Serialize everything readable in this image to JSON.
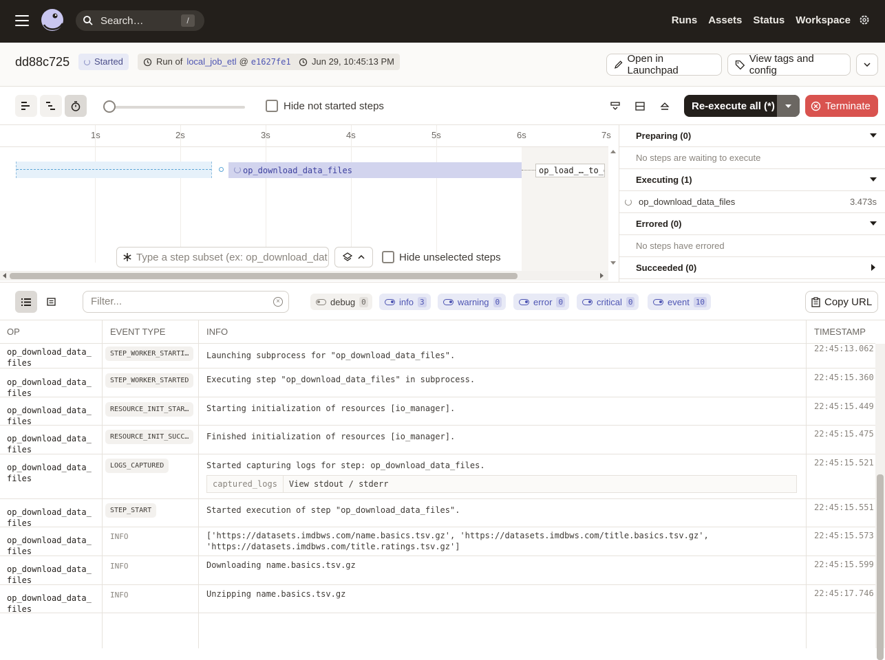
{
  "nav": {
    "search_placeholder": "Search…",
    "search_key": "/",
    "links": [
      "Runs",
      "Assets",
      "Status",
      "Workspace"
    ]
  },
  "run": {
    "id": "dd88c725",
    "status": "Started",
    "run_of_prefix": "Run of",
    "job": "local_job_etl",
    "at": "@",
    "snapshot": "e1627fe1",
    "time": "Jun 29, 10:45:13 PM",
    "open_launchpad": "Open in Launchpad",
    "view_tags": "View tags and config"
  },
  "toolbar": {
    "hide_not_started": "Hide not started steps",
    "reexecute": "Re-execute all (*)",
    "terminate": "Terminate"
  },
  "gantt": {
    "ticks": [
      "1s",
      "2s",
      "3s",
      "4s",
      "5s",
      "6s",
      "7s"
    ],
    "exec_step": "op_download_data_files",
    "next_step": "op_load_…_to_db",
    "subset_placeholder": "Type a step subset (ex: op_download_dat",
    "hide_unselected": "Hide unselected steps"
  },
  "steps": {
    "preparing": "Preparing (0)",
    "preparing_empty": "No steps are waiting to execute",
    "executing": "Executing (1)",
    "executing_item": "op_download_data_files",
    "executing_time": "3.473s",
    "errored": "Errored (0)",
    "errored_empty": "No steps have errored",
    "succeeded": "Succeeded (0)"
  },
  "filters": {
    "placeholder": "Filter...",
    "levels": [
      {
        "label": "debug",
        "count": "0"
      },
      {
        "label": "info",
        "count": "3"
      },
      {
        "label": "warning",
        "count": "0"
      },
      {
        "label": "error",
        "count": "0"
      },
      {
        "label": "critical",
        "count": "0"
      },
      {
        "label": "event",
        "count": "10"
      }
    ],
    "copy_url": "Copy URL"
  },
  "logs": {
    "columns": [
      "OP",
      "EVENT TYPE",
      "INFO",
      "TIMESTAMP"
    ],
    "rows": [
      {
        "op": "op_download_data_files",
        "event": "STEP_WORKER_STARTI…",
        "info": "Launching subprocess for \"op_download_data_files\".",
        "ts": "22:45:13.062"
      },
      {
        "op": "op_download_data_files",
        "event": "STEP_WORKER_STARTED",
        "info": "Executing step \"op_download_data_files\" in subprocess.",
        "ts": "22:45:15.360"
      },
      {
        "op": "op_download_data_files",
        "event": "RESOURCE_INIT_STAR…",
        "info": "Starting initialization of resources [io_manager].",
        "ts": "22:45:15.449"
      },
      {
        "op": "op_download_data_files",
        "event": "RESOURCE_INIT_SUCC…",
        "info": "Finished initialization of resources [io_manager].",
        "ts": "22:45:15.475"
      },
      {
        "op": "op_download_data_files",
        "event": "LOGS_CAPTURED",
        "info": "Started capturing logs for step: op_download_data_files.",
        "ts": "22:45:15.521",
        "box_key": "captured_logs",
        "box_val": "View stdout / stderr"
      },
      {
        "op": "op_download_data_files",
        "event": "STEP_START",
        "info": "Started execution of step \"op_download_data_files\".",
        "ts": "22:45:15.551"
      },
      {
        "op": "op_download_data_files",
        "event": "INFO",
        "info": "['https://datasets.imdbws.com/name.basics.tsv.gz', 'https://datasets.imdbws.com/title.basics.tsv.gz', 'https://datasets.imdbws.com/title.ratings.tsv.gz']",
        "ts": "22:45:15.573"
      },
      {
        "op": "op_download_data_files",
        "event": "INFO",
        "info": "Downloading name.basics.tsv.gz",
        "ts": "22:45:15.599"
      },
      {
        "op": "op_download_data_files",
        "event": "INFO",
        "info": "Unzipping name.basics.tsv.gz",
        "ts": "22:45:17.746"
      }
    ]
  }
}
